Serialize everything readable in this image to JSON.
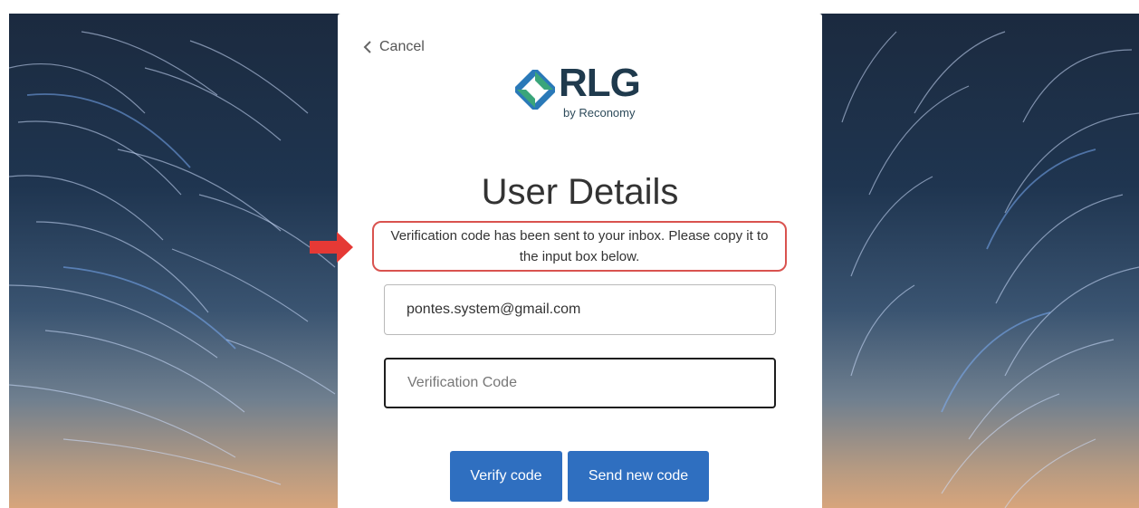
{
  "header": {
    "cancel_label": "Cancel"
  },
  "logo": {
    "name": "RLG",
    "tagline": "by Reconomy"
  },
  "page": {
    "title": "User Details"
  },
  "notice": {
    "text": "Verification code has been sent to your inbox. Please copy it to the input box below."
  },
  "form": {
    "email_value": "pontes.system@gmail.com",
    "code_placeholder": "Verification Code"
  },
  "actions": {
    "verify_label": "Verify code",
    "send_label": "Send new code"
  },
  "colors": {
    "primary": "#2f6fc0",
    "notice_border": "#d9534f",
    "arrow": "#e53935",
    "logo_dark": "#1f3a4d",
    "logo_green": "#3aa57a",
    "logo_blue": "#2a79b8"
  },
  "icons": {
    "back": "chevron-left-icon",
    "annotation": "arrow-right-icon",
    "brand": "rlg-logo-icon"
  }
}
